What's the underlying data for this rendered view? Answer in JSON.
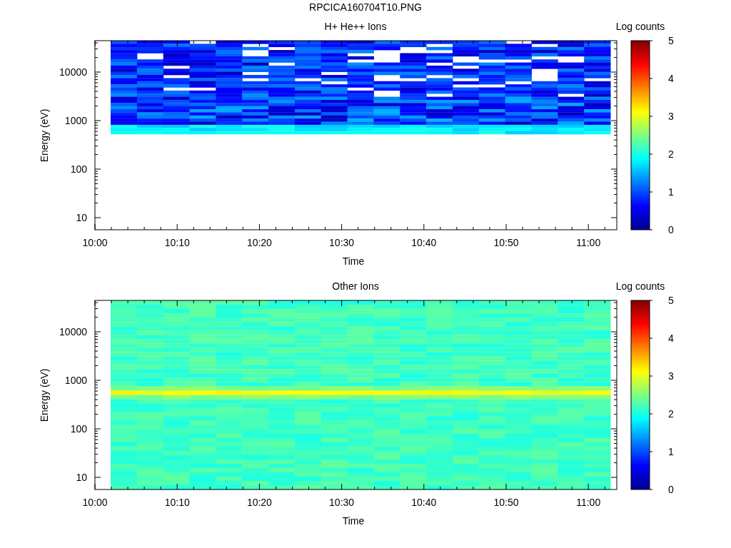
{
  "title": "RPCICA160704T10.PNG",
  "panels": [
    {
      "kind": "sparse",
      "title": "H+ He++ Ions",
      "colorbar_label": "Log counts",
      "colorbar_ticks": [
        "5",
        "4",
        "3",
        "2",
        "1",
        "0"
      ],
      "ylabel": "Energy (eV)",
      "yticks": [
        "10000",
        "1000",
        "100",
        "10"
      ],
      "xticks": [
        "10:00",
        "10:10",
        "10:20",
        "10:30",
        "10:40",
        "10:50",
        "11:00"
      ],
      "xlabel": "Time"
    },
    {
      "kind": "dense",
      "title": "Other Ions",
      "colorbar_label": "Log counts",
      "colorbar_ticks": [
        "5",
        "4",
        "3",
        "2",
        "1",
        "0"
      ],
      "ylabel": "Energy (eV)",
      "yticks": [
        "10000",
        "1000",
        "100",
        "10"
      ],
      "xticks": [
        "10:00",
        "10:10",
        "10:20",
        "10:30",
        "10:40",
        "10:50",
        "11:00"
      ],
      "xlabel": "Time"
    }
  ]
}
